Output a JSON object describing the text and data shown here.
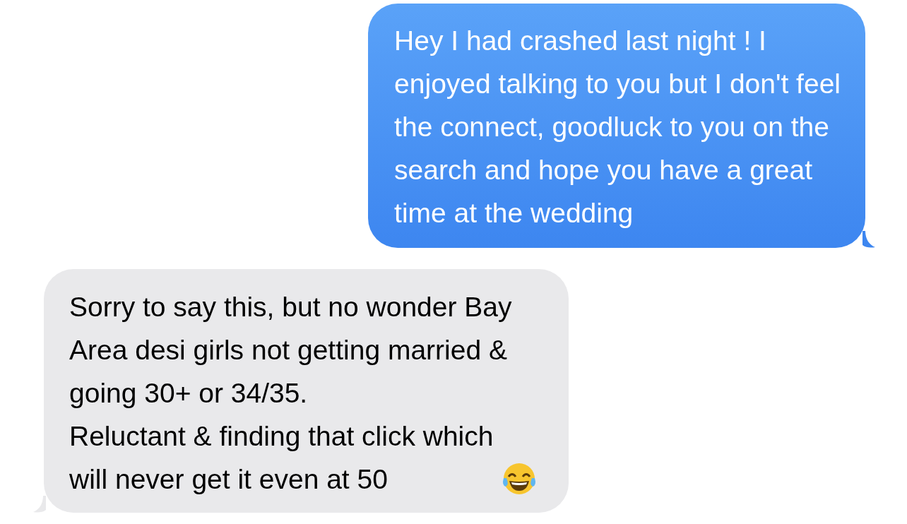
{
  "messages": [
    {
      "kind": "sent",
      "parts": [
        {
          "kind": "text",
          "text": "Hey I had crashed last night ! I\nenjoyed talking to you but I don't feel\nthe connect, goodluck to you on the\nsearch and hope you have a great\ntime at the wedding"
        }
      ]
    },
    {
      "kind": "received",
      "parts": [
        {
          "kind": "text",
          "text": "Sorry to say this, but no wonder Bay\nArea desi girls not getting married &\ngoing 30+ or 34/35.\nReluctant & finding that click which\nwill never get it even at 50"
        },
        {
          "kind": "laughing_emoji"
        }
      ]
    }
  ]
}
